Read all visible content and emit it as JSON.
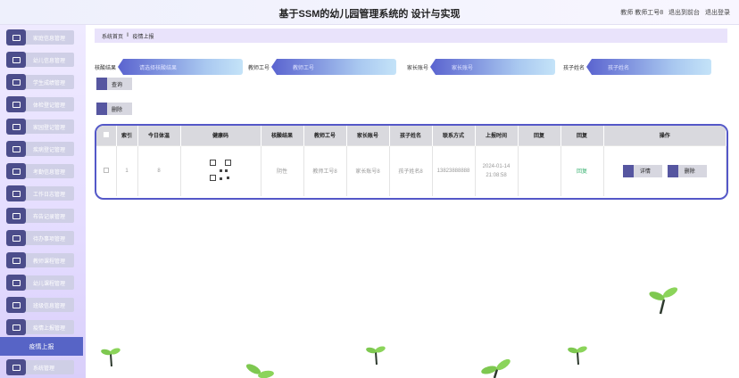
{
  "header": {
    "title": "基于SSM的幼儿园管理系统的 设计与实现",
    "user": "教师 教师工号8",
    "back_link": "退出到前台",
    "logout_link": "退出登录"
  },
  "sidebar": {
    "items": [
      {
        "label": "家庭信息管理"
      },
      {
        "label": "幼儿信息管理"
      },
      {
        "label": "学生成绩管理"
      },
      {
        "label": "体检登记管理"
      },
      {
        "label": "家园登记管理"
      },
      {
        "label": "疾病登记管理"
      },
      {
        "label": "考勤信息管理"
      },
      {
        "label": "工作日志管理"
      },
      {
        "label": "布告记录管理"
      },
      {
        "label": "待办事项管理"
      },
      {
        "label": "教师课程管理"
      },
      {
        "label": "幼儿课程管理"
      },
      {
        "label": "班级信息管理"
      },
      {
        "label": "疫情上报管理"
      }
    ],
    "active": "疫情上报",
    "last_item": "系统管理"
  },
  "breadcrumb": {
    "home": "系统首页",
    "sep": "ǁ",
    "current": "疫情上报"
  },
  "search": {
    "fields": [
      {
        "label": "核酸结果",
        "placeholder": "请选择核酸结果"
      },
      {
        "label": "教师工号",
        "placeholder": "教师工号"
      },
      {
        "label": "家长账号",
        "placeholder": "家长账号"
      },
      {
        "label": "孩子姓名",
        "placeholder": "孩子姓名"
      }
    ],
    "query_button": "查询",
    "delete_button": "删除"
  },
  "table": {
    "headers": [
      "",
      "索引",
      "今日体温",
      "健康码",
      "核酸结果",
      "教师工号",
      "家长账号",
      "孩子姓名",
      "联系方式",
      "上报时间",
      "回复",
      "回复",
      "操作"
    ],
    "rows": [
      {
        "index": "1",
        "temperature": "8",
        "result": "阴性",
        "teacher_no": "教师工号8",
        "parent_acct": "家长账号8",
        "child_name": "孩子姓名8",
        "phone": "13823888888",
        "time": "2024-01-14 21:08:58",
        "reply": "",
        "reply_action": "回复",
        "detail_btn": "详情",
        "delete_btn": "删除"
      }
    ]
  }
}
